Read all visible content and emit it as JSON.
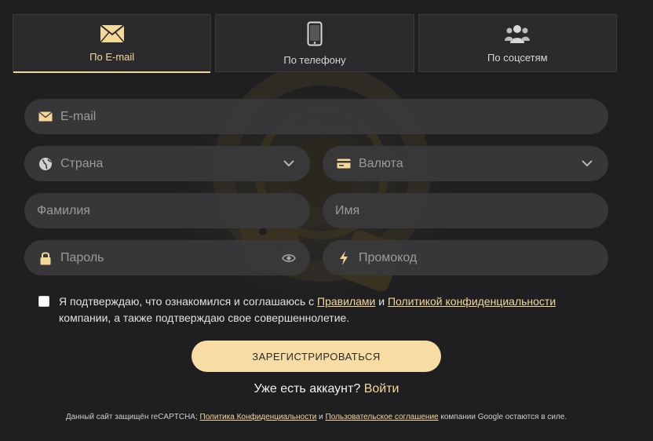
{
  "tabs": [
    {
      "label": "По E-mail",
      "icon": "envelope-icon",
      "active": true
    },
    {
      "label": "По телефону",
      "icon": "phone-icon",
      "active": false
    },
    {
      "label": "По соцсетям",
      "icon": "users-icon",
      "active": false
    }
  ],
  "form": {
    "email": {
      "placeholder": "E-mail",
      "icon": "envelope-icon"
    },
    "country": {
      "placeholder": "Страна",
      "icon": "globe-icon",
      "trailing_icon": "chevron-down-icon"
    },
    "currency": {
      "placeholder": "Валюта",
      "icon": "card-icon",
      "trailing_icon": "chevron-down-icon"
    },
    "surname": {
      "placeholder": "Фамилия"
    },
    "name": {
      "placeholder": "Имя"
    },
    "password": {
      "placeholder": "Пароль",
      "icon": "lock-icon",
      "trailing_icon": "eye-icon"
    },
    "promo": {
      "placeholder": "Промокод",
      "icon": "lightning-icon"
    }
  },
  "consent": {
    "text_before": "Я подтверждаю, что ознакомился и соглашаюсь с ",
    "rules_link": "Правилами",
    "text_and": " и ",
    "privacy_link": "Политикой конфиденциальности",
    "text_after": "компании, а также подтверждаю свое совершеннолетие."
  },
  "submit_label": "ЗАРЕГИСТРИРОВАТЬСЯ",
  "login": {
    "question": "Уже есть аккаунт? ",
    "link": "Войти"
  },
  "footer": {
    "text_before": "Данный сайт защищён reCAPTCHA; ",
    "privacy_link": "Политика Конфиденциальности",
    "text_and": " и ",
    "terms_link": "Пользовательское соглашение",
    "text_after": " компании Google остаются в силе."
  },
  "colors": {
    "accent": "#f3d89a",
    "background": "#1f1f21",
    "field": "#3a3a3c",
    "button": "#f7dca4"
  }
}
